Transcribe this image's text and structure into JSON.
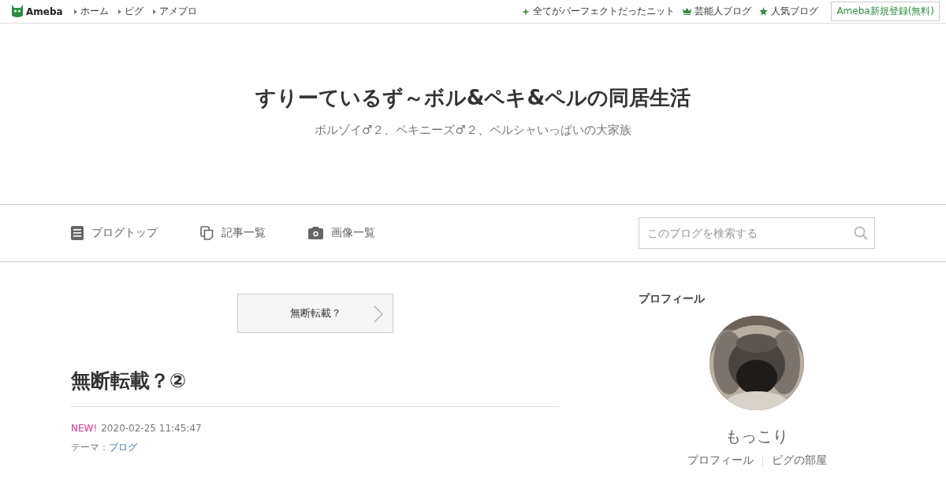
{
  "topbar": {
    "logo": "Ameba",
    "links": [
      "ホーム",
      "ピグ",
      "アメブロ"
    ],
    "right_links": [
      {
        "kind": "sparkle",
        "label": "全てがパーフェクトだったニット"
      },
      {
        "kind": "crown",
        "label": "芸能人ブログ"
      },
      {
        "kind": "star",
        "label": "人気ブログ"
      }
    ],
    "register": "Ameba新規登録(無料)"
  },
  "header": {
    "title": "すりーているず～ボル&ペキ&ペルの同居生活",
    "subtitle": "ボルゾイ♂２、ペキニーズ♂２、ペルシャいっぱいの大家族"
  },
  "nav": {
    "items": [
      {
        "kind": "document",
        "label": "ブログトップ"
      },
      {
        "kind": "copy",
        "label": "記事一覧"
      },
      {
        "kind": "camera",
        "label": "画像一覧"
      }
    ],
    "search": {
      "placeholder": "このブログを検索する"
    }
  },
  "article": {
    "prev_link": "無断転載？",
    "title": "無断転載？②",
    "new_badge": "NEW!",
    "date": "2020-02-25 11:45:47",
    "theme_label": "テーマ：",
    "theme": "ブログ"
  },
  "sidebar": {
    "heading": "プロフィール",
    "avatar": {
      "kind": "picture"
    },
    "name": "もっこり",
    "links": [
      "プロフィール",
      "ピグの部屋"
    ]
  }
}
